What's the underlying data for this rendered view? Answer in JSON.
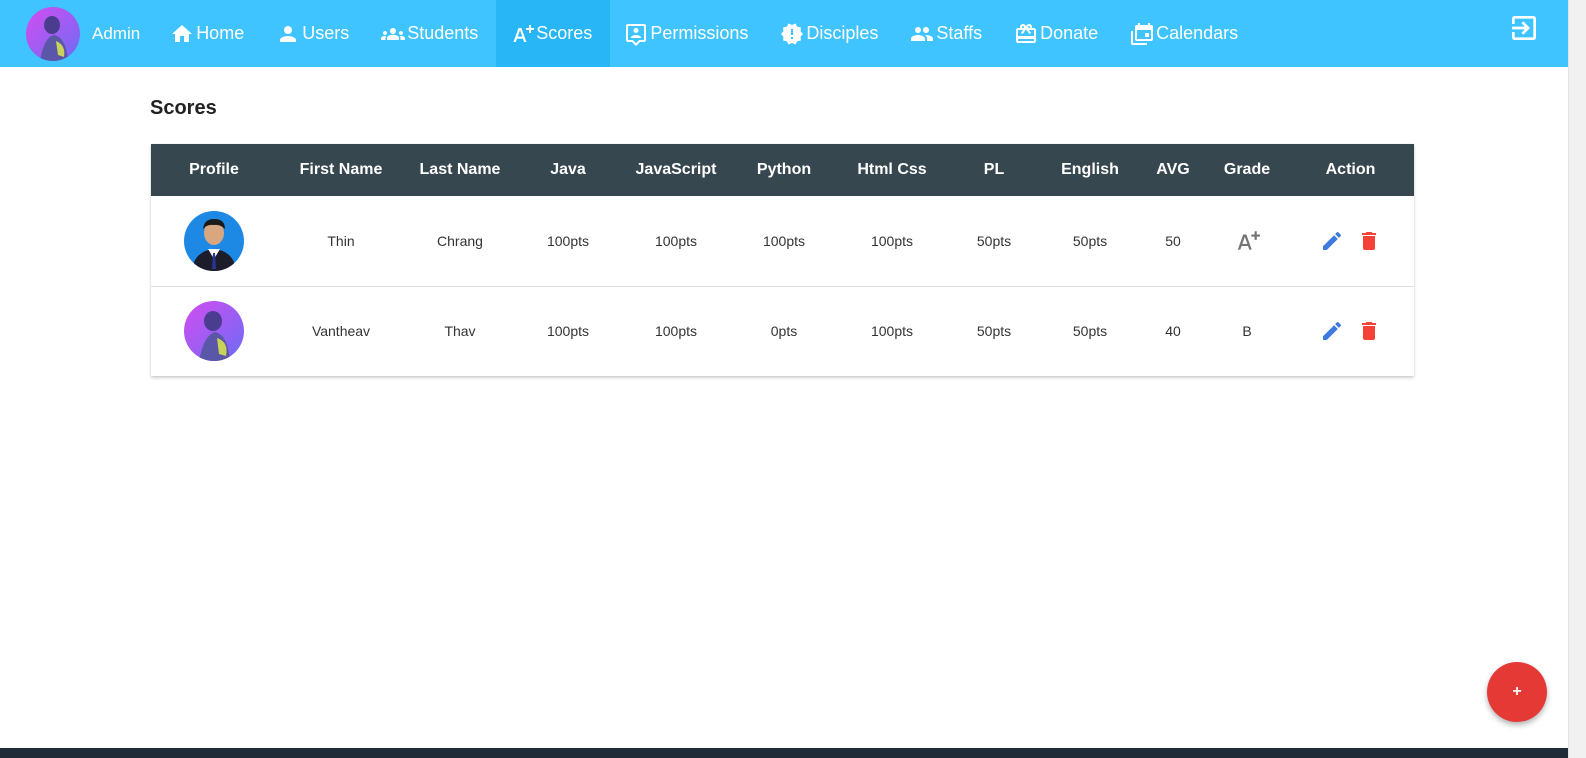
{
  "nav": {
    "admin_label": "Admin",
    "items": [
      {
        "label": "Home",
        "icon": "home-icon"
      },
      {
        "label": "Users",
        "icon": "user-icon"
      },
      {
        "label": "Students",
        "icon": "group-icon"
      },
      {
        "label": "Scores",
        "icon": "grade-icon",
        "active": true
      },
      {
        "label": "Permissions",
        "icon": "comment-account-icon"
      },
      {
        "label": "Disciples",
        "icon": "alert-badge-icon"
      },
      {
        "label": "Staffs",
        "icon": "people-icon"
      },
      {
        "label": "Donate",
        "icon": "gift-icon"
      },
      {
        "label": "Calendars",
        "icon": "calendar-icon"
      }
    ],
    "logout_icon": "logout-icon",
    "bar_color": "#40c4ff",
    "active_color": "#29b6f6"
  },
  "page": {
    "title": "Scores"
  },
  "table": {
    "header_color": "#37474f",
    "columns": [
      "Profile",
      "First Name",
      "Last Name",
      "Java",
      "JavaScript",
      "Python",
      "Html Css",
      "PL",
      "English",
      "AVG",
      "Grade",
      "Action"
    ],
    "rows": [
      {
        "first_name": "Thin",
        "last_name": "Chrang",
        "java": "100pts",
        "javascript": "100pts",
        "python": "100pts",
        "html_css": "100pts",
        "pl": "50pts",
        "english": "50pts",
        "avg": "50",
        "grade": "A+",
        "grade_display": "icon"
      },
      {
        "first_name": "Vantheav",
        "last_name": "Thav",
        "java": "100pts",
        "javascript": "100pts",
        "python": "0pts",
        "html_css": "100pts",
        "pl": "50pts",
        "english": "50pts",
        "avg": "40",
        "grade": "B",
        "grade_display": "text"
      }
    ]
  },
  "fab": {
    "label": "+",
    "color": "#e53935"
  },
  "colors": {
    "edit": "#3f7bde",
    "delete": "#f44336"
  }
}
